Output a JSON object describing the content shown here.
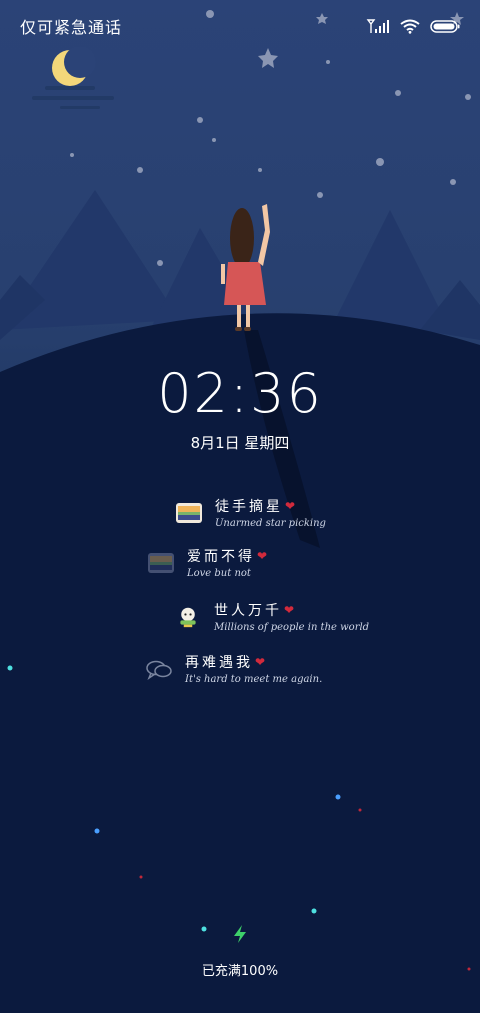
{
  "status_bar": {
    "carrier_text": "仅可紧急通话",
    "icons": [
      "signal-icon",
      "wifi-icon",
      "battery-icon"
    ]
  },
  "lockscreen": {
    "time": "02:36",
    "date": "8月1日 星期四"
  },
  "notifications": [
    {
      "title": "徒手摘星",
      "subtitle": "Unarmed star picking",
      "icon": "sunset-photo-icon"
    },
    {
      "title": "爱而不得",
      "subtitle": "Love but not",
      "icon": "sunset-photo-icon"
    },
    {
      "title": "世人万千",
      "subtitle": "Millions of people in the world",
      "icon": "cartoon-character-icon"
    },
    {
      "title": "再难遇我",
      "subtitle": "It's hard to meet me again.",
      "icon": "chat-bubbles-icon"
    }
  ],
  "charging": {
    "text": "已充满100%",
    "icon": "lightning-icon"
  },
  "colors": {
    "sky_top": "#2b4377",
    "hill": "#0b1a3e",
    "mountain": "#22386a",
    "moon": "#f3d77a",
    "heart": "#d22a3c",
    "charge_icon": "#3ed16a"
  }
}
